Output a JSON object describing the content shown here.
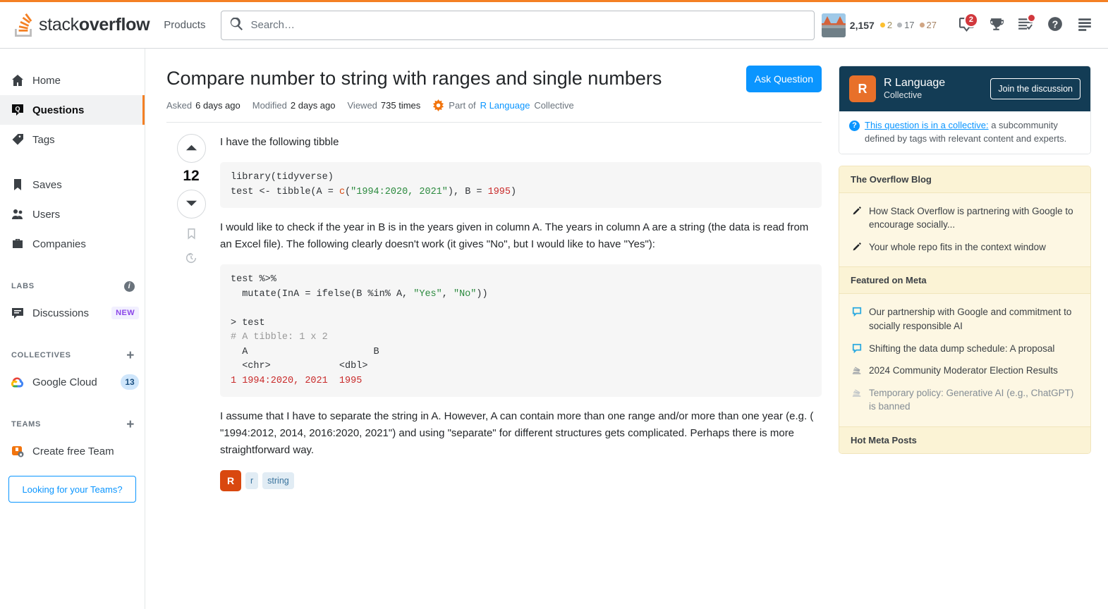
{
  "header": {
    "logo_text_light": "stack",
    "logo_text_bold": "overflow",
    "products_label": "Products",
    "search_placeholder": "Search…",
    "search_value": "",
    "reputation": "2,157",
    "gold_count": "2",
    "silver_count": "17",
    "bronze_count": "27",
    "inbox_count": "2",
    "icons": {
      "search": "search-icon",
      "inbox": "inbox-icon",
      "achievements": "trophy-icon",
      "review": "review-queues-icon",
      "help": "help-icon",
      "menu": "hamburger-icon"
    }
  },
  "sidebar": {
    "items": [
      {
        "label": "Home",
        "icon": "home-icon",
        "active": false
      },
      {
        "label": "Questions",
        "icon": "questions-icon",
        "active": true
      },
      {
        "label": "Tags",
        "icon": "tag-icon",
        "active": false
      },
      {
        "label": "Saves",
        "icon": "bookmark-icon",
        "active": false
      },
      {
        "label": "Users",
        "icon": "users-icon",
        "active": false
      },
      {
        "label": "Companies",
        "icon": "briefcase-icon",
        "active": false
      }
    ],
    "labs_header": "LABS",
    "discussions_label": "Discussions",
    "discussions_badge": "NEW",
    "collectives_header": "COLLECTIVES",
    "collectives_items": [
      {
        "label": "Google Cloud",
        "count": "13"
      }
    ],
    "teams_header": "TEAMS",
    "create_team_label": "Create free Team",
    "looking_teams_label": "Looking for your Teams?"
  },
  "question": {
    "title": "Compare number to string with ranges and single numbers",
    "ask_button": "Ask Question",
    "meta": {
      "asked_label": "Asked",
      "asked_value": "6 days ago",
      "modified_label": "Modified",
      "modified_value": "2 days ago",
      "viewed_label": "Viewed",
      "viewed_value": "735 times",
      "collective_prefix": "Part of",
      "collective_link": "R Language",
      "collective_suffix": "Collective"
    },
    "votes": "12",
    "paragraph_1": "I have the following tibble",
    "code_1_line_1_a": "library(tidyverse)",
    "code_1_line_2_a": "test <- tibble(A = ",
    "code_1_line_2_fn": "c",
    "code_1_line_2_b": "(",
    "code_1_line_2_str": "\"1994:2020, 2021\"",
    "code_1_line_2_c": "), B = ",
    "code_1_line_2_num": "1995",
    "code_1_line_2_d": ")",
    "paragraph_2": "I would like to check if the year in B is in the years given in column A. The years in column A are a string (the data is read from an Excel file). The following clearly doesn't work (it gives \"No\", but I would like to have \"Yes\"):",
    "code_2_l1": "test %>%",
    "code_2_l2_a": "  mutate(InA = ifelse(B %in% A, ",
    "code_2_l2_yes": "\"Yes\"",
    "code_2_l2_b": ", ",
    "code_2_l2_no": "\"No\"",
    "code_2_l2_c": "))",
    "code_2_l3": "> test",
    "code_2_l4": "# A tibble: 1 x 2",
    "code_2_l5": "  A                      B",
    "code_2_l6": "  <chr>            <dbl>",
    "code_2_l7_num1": "1 1994",
    "code_2_l7_sep": ":",
    "code_2_l7_num2": "2020, 2021  1995",
    "paragraph_3": "I assume that I have to separate the string in A. However, A can contain more than one range and/or more than one year (e.g. ( \"1994:2012, 2014, 2016:2020, 2021\") and using \"separate\" for different structures gets complicated. Perhaps there is more straightforward way.",
    "tags": [
      {
        "label": "R",
        "type": "collective"
      },
      {
        "label": "r",
        "type": "normal"
      },
      {
        "label": "string",
        "type": "normal"
      }
    ]
  },
  "rightbar": {
    "collective": {
      "avatar_letter": "R",
      "name": "R Language",
      "subtitle": "Collective",
      "join_button": "Join the discussion",
      "note_link": "This question is in a collective:",
      "note_rest": " a subcommunity defined by tags with relevant content and experts."
    },
    "sections": [
      {
        "title": "The Overflow Blog",
        "items": [
          {
            "text": "How Stack Overflow is partnering with Google to encourage socially...",
            "icon": "pencil-icon",
            "muted": false
          },
          {
            "text": "Your whole repo fits in the context window",
            "icon": "pencil-icon",
            "muted": false
          }
        ]
      },
      {
        "title": "Featured on Meta",
        "items": [
          {
            "text": "Our partnership with Google and commitment to socially responsible AI",
            "icon": "speech-bubble-icon",
            "muted": false
          },
          {
            "text": "Shifting the data dump schedule: A proposal",
            "icon": "speech-bubble-icon",
            "muted": false
          },
          {
            "text": "2024 Community Moderator Election Results",
            "icon": "stacks-icon",
            "muted": false
          },
          {
            "text": "Temporary policy: Generative AI (e.g., ChatGPT) is banned",
            "icon": "stacks-icon",
            "muted": true
          }
        ]
      },
      {
        "title": "Hot Meta Posts",
        "items": []
      }
    ]
  },
  "colors": {
    "accent_orange": "#f48024",
    "link_blue": "#0a95ff",
    "collective_dark": "#133c55",
    "collective_orange": "#e8702a",
    "meta_yellow": "#fdf7e3"
  }
}
